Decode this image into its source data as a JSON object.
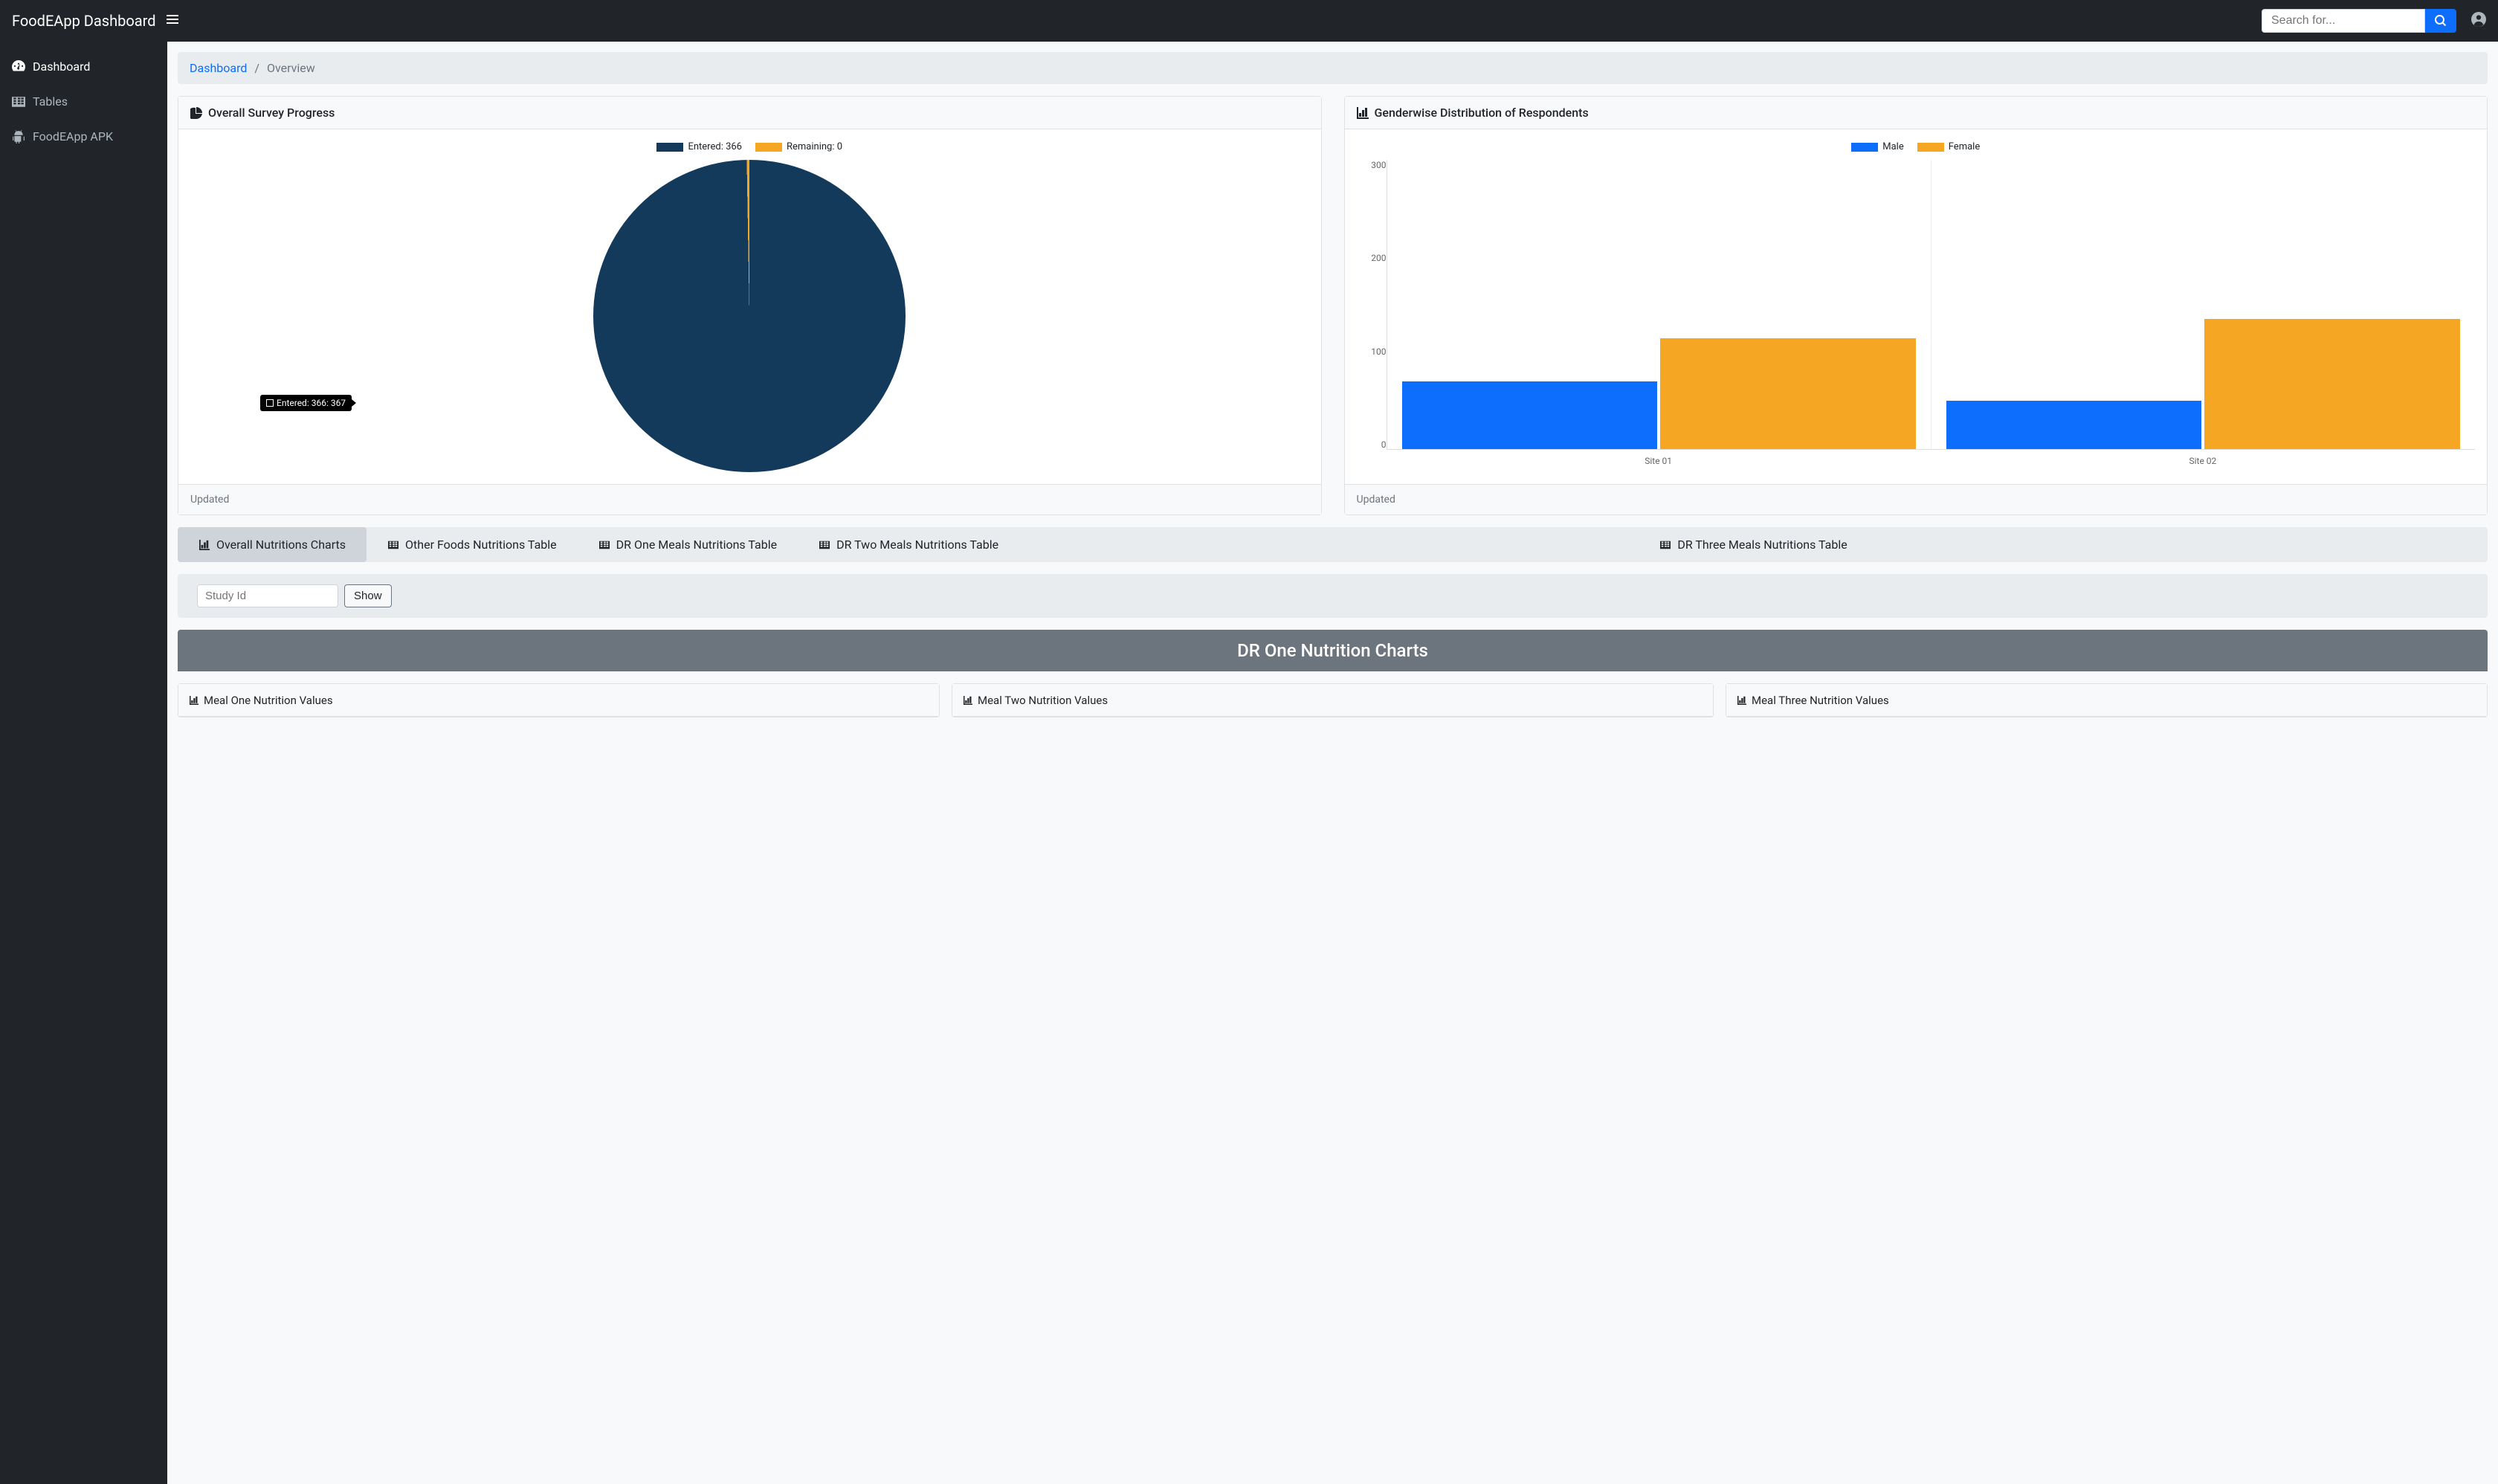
{
  "app": {
    "title": "FoodEApp Dashboard"
  },
  "search": {
    "placeholder": "Search for..."
  },
  "sidebar": {
    "items": [
      {
        "label": "Dashboard",
        "icon": "gauge"
      },
      {
        "label": "Tables",
        "icon": "table"
      },
      {
        "label": "FoodEApp APK",
        "icon": "android"
      }
    ]
  },
  "breadcrumb": {
    "root": "Dashboard",
    "current": "Overview"
  },
  "cards": {
    "survey": {
      "title": "Overall Survey Progress",
      "footer": "Updated"
    },
    "gender": {
      "title": "Genderwise Distribution of Respondents",
      "footer": "Updated"
    }
  },
  "chart_data": [
    {
      "type": "pie",
      "title": "Overall Survey Progress",
      "series": [
        {
          "name": "Entered: 366",
          "value": 366,
          "color": "#13395b"
        },
        {
          "name": "Remaining: 0",
          "value": 1,
          "color": "#f5a623"
        }
      ],
      "tooltip": "Entered: 366: 367"
    },
    {
      "type": "bar",
      "title": "Genderwise Distribution of Respondents",
      "categories": [
        "Site 01",
        "Site 02"
      ],
      "series": [
        {
          "name": "Male",
          "color": "#0d6efd",
          "values": [
            70,
            50
          ]
        },
        {
          "name": "Female",
          "color": "#f5a623",
          "values": [
            115,
            135
          ]
        }
      ],
      "ylim": [
        0,
        300
      ],
      "yticks": [
        0,
        100,
        200,
        300
      ]
    }
  ],
  "tabs": [
    {
      "label": "Overall Nutritions Charts",
      "icon": "barchart"
    },
    {
      "label": "Other Foods Nutritions Table",
      "icon": "table"
    },
    {
      "label": "DR One Meals Nutritions Table",
      "icon": "table"
    },
    {
      "label": "DR Two Meals Nutritions Table",
      "icon": "table"
    },
    {
      "label": "DR Three Meals Nutritions Table",
      "icon": "table"
    }
  ],
  "filter": {
    "placeholder": "Study Id",
    "button": "Show"
  },
  "section": {
    "banner": "DR One Nutrition Charts",
    "sub_cards": [
      {
        "label": "Meal One Nutrition Values"
      },
      {
        "label": "Meal Two Nutrition Values"
      },
      {
        "label": "Meal Three Nutrition Values"
      }
    ]
  }
}
